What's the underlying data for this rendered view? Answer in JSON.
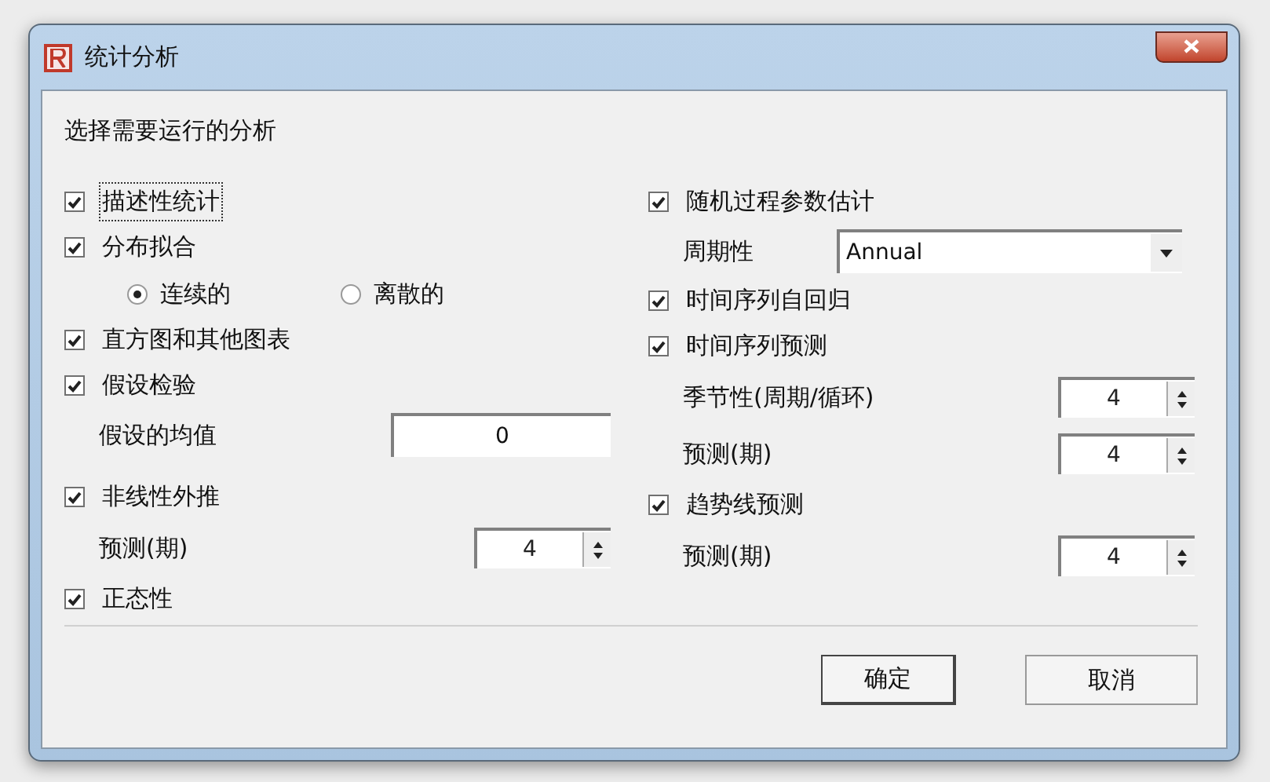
{
  "window": {
    "title": "统计分析"
  },
  "heading": "选择需要运行的分析",
  "left_column": [
    {
      "kind": "checkbox",
      "label": "描述性统计",
      "checked": true,
      "focused": true
    },
    {
      "kind": "checkbox",
      "label": "分布拟合",
      "checked": true,
      "focused": false
    },
    {
      "kind": "radio_group",
      "options": [
        {
          "label": "连续的",
          "selected": true
        },
        {
          "label": "离散的",
          "selected": false
        }
      ]
    },
    {
      "kind": "checkbox",
      "label": "直方图和其他图表",
      "checked": true,
      "focused": false
    },
    {
      "kind": "checkbox",
      "label": "假设检验",
      "checked": true,
      "focused": false
    },
    {
      "kind": "field",
      "label": "假设的均值",
      "value": "0"
    },
    {
      "kind": "checkbox",
      "label": "非线性外推",
      "checked": true,
      "focused": false
    },
    {
      "kind": "spinner",
      "label": "预测(期)",
      "value": "4"
    },
    {
      "kind": "checkbox",
      "label": "正态性",
      "checked": true,
      "focused": false
    }
  ],
  "right_column": [
    {
      "kind": "checkbox",
      "label": "随机过程参数估计",
      "checked": true,
      "focused": false
    },
    {
      "kind": "dropdown",
      "label": "周期性",
      "value": "Annual"
    },
    {
      "kind": "checkbox",
      "label": "时间序列自回归",
      "checked": true,
      "focused": false
    },
    {
      "kind": "checkbox",
      "label": "时间序列预测",
      "checked": true,
      "focused": false
    },
    {
      "kind": "spinner",
      "label": "季节性(周期/循环)",
      "value": "4"
    },
    {
      "kind": "spinner",
      "label": "预测(期)",
      "value": "4"
    },
    {
      "kind": "checkbox",
      "label": "趋势线预测",
      "checked": true,
      "focused": false
    },
    {
      "kind": "spinner",
      "label": "预测(期)",
      "value": "4"
    }
  ],
  "buttons": [
    "确定",
    "取消"
  ]
}
